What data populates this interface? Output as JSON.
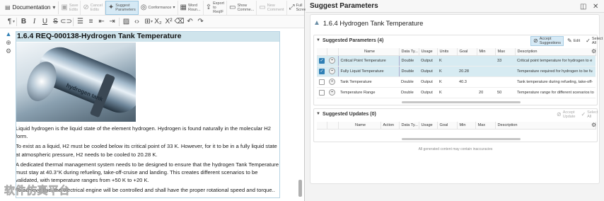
{
  "editor": {
    "doc_selector": "Documentation",
    "toolbar": [
      {
        "name": "save-edits-button",
        "icon": "save-icon",
        "label": "Save\nEdits",
        "disabled": true
      },
      {
        "name": "cancel-edits-button",
        "icon": "cancel-icon",
        "label": "Cancel\nEdits",
        "disabled": true
      },
      {
        "name": "suggest-parameters-button",
        "icon": "suggest-icon",
        "label": "Suggest\nParameters",
        "active": true
      },
      {
        "name": "conformance-button",
        "icon": "conformance-icon",
        "label": "Conformance"
      },
      {
        "name": "word-round-button",
        "icon": "word-icon",
        "label": "Word\nRoun..."
      },
      {
        "name": "export-to-reqif-button",
        "icon": "export-icon",
        "label": "Export to\nReqIF"
      },
      {
        "name": "show-comments-button",
        "icon": "comment-icon",
        "label": "Show\nComme..."
      },
      {
        "name": "new-comment-button",
        "icon": "new-comment-icon",
        "label": "New\nComment",
        "disabled": true
      },
      {
        "name": "full-screen-button",
        "icon": "fullscreen-icon",
        "label": "Full\nScreen"
      }
    ],
    "doc": {
      "title": "1.6.4 REQ-000138-Hydrogen Tank Temperature",
      "image_label": "hydrogen tank",
      "paragraphs": [
        "Liquid hydrogen is the liquid state of the element hydrogen. Hydrogen is found naturally in the molecular H2 form.",
        "To exist as a liquid, H2 must be cooled below its critical point of 33 K. However, for it to be in a fully liquid state at atmospheric pressure, H2 needs to be cooled to 20.28 K.",
        "A dedicated thermal management system needs to be designed to ensure that the hydrogen Tank Temperature must stay at 40.3°K during refueling, take-off-cruise and landing. This creates different scenarios to be validated, with temperature ranges from +50 K to +20 K.",
        "To achieve this, the electrical engine will be controlled and shall have the proper rotational speed and torque.."
      ]
    },
    "watermark": "软件仿真平台"
  },
  "panel": {
    "header_title": "Suggest Parameters",
    "body_title": "1.6.4 Hydrogen Tank Temperature",
    "suggested_parameters": {
      "title": "Suggested Parameters (4)",
      "actions": {
        "accept": "Accept\nSuggestions",
        "edit": "Edit",
        "select_all": "Select\nAll"
      },
      "columns": [
        "",
        "",
        "Name",
        "Data Ty...",
        "Usage",
        "Units",
        "Goal",
        "Min",
        "Max",
        "Description"
      ],
      "rows": [
        {
          "checked": true,
          "name": "Critical Point Temperature",
          "data_type": "Double",
          "usage": "Output",
          "units": "K",
          "goal": "",
          "min": "",
          "max": "33",
          "description": "Critical point temperature for hydrogen to e"
        },
        {
          "checked": true,
          "name": "Fully Liquid Temperature",
          "data_type": "Double",
          "usage": "Output",
          "units": "K",
          "goal": "20.28",
          "min": "",
          "max": "",
          "description": "Temperature required for hydrogen to be fu"
        },
        {
          "checked": false,
          "name": "Tank Temperature",
          "data_type": "Double",
          "usage": "Output",
          "units": "K",
          "goal": "40.3",
          "min": "",
          "max": "",
          "description": "Tank temperature during refueling, take-off-"
        },
        {
          "checked": false,
          "name": "Temperature Range",
          "data_type": "Double",
          "usage": "Output",
          "units": "K",
          "goal": "",
          "min": "20",
          "max": "50",
          "description": "Temperature range for different scenarios to"
        }
      ]
    },
    "suggested_updates": {
      "title": "Suggested Updates (0)",
      "actions": {
        "accept": "Accept\nUpdate",
        "select_all": "Select\nAll"
      },
      "columns": [
        "",
        "",
        "Name",
        "Action",
        "Data Ty...",
        "Usage",
        "Goal",
        "Min",
        "Max",
        "Description"
      ]
    },
    "footnote": "All generated content may contain inaccuracies"
  }
}
